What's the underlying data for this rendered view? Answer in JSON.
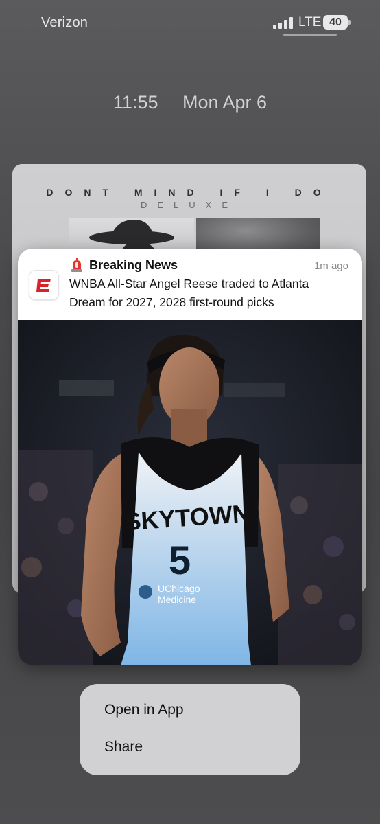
{
  "status_bar": {
    "carrier": "Verizon",
    "network": "LTE",
    "battery": "40"
  },
  "lock_screen": {
    "time": "11:55",
    "date": "Mon Apr 6"
  },
  "album_card": {
    "title": "DONT MIND IF I DO",
    "subtitle": "DELUXE"
  },
  "notification": {
    "app_icon": "espn-logo-icon",
    "title_icon": "siren-icon",
    "title": "Breaking News",
    "time": "1m ago",
    "body": "WNBA All-Star Angel Reese traded to Atlanta Dream for 2027, 2028 first-round picks",
    "image": {
      "jersey_text": "SKYTOWN",
      "jersey_number": "5",
      "sponsor_line1": "UChicago",
      "sponsor_line2": "Medicine"
    }
  },
  "context_menu": {
    "items": [
      "Open in App",
      "Share"
    ]
  },
  "colors": {
    "espn_red": "#d8232a",
    "jersey_blue": "#8fc2ea",
    "menu_bg": "#d6d6d9"
  }
}
